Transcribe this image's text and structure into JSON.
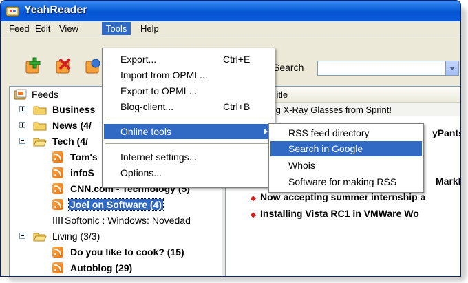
{
  "window": {
    "title": "YeahReader"
  },
  "menubar": {
    "items": [
      "Feed",
      "Edit",
      "View",
      "Tools",
      "Help"
    ],
    "active": "Tools"
  },
  "toolbar": {
    "search_label": "Search"
  },
  "tree": {
    "root": "Feeds",
    "rows": [
      {
        "label": "Business",
        "kind": "folder",
        "expander": "plus"
      },
      {
        "label": "News (4/",
        "kind": "folder",
        "expander": "plus"
      },
      {
        "label": "Tech (4/",
        "kind": "folder",
        "expander": "minus"
      },
      {
        "label": "Tom's",
        "kind": "feed"
      },
      {
        "label": "infoS",
        "kind": "feed"
      },
      {
        "label": "CNN.com - Technology (5)",
        "kind": "feed"
      },
      {
        "label": "Joel on Software (4)",
        "kind": "feed",
        "selected": true
      },
      {
        "label": "Softonic : Windows: Novedad",
        "kind": "feed-plain"
      },
      {
        "label": "Living (3/3)",
        "kind": "folder",
        "expander": "minus"
      },
      {
        "label": "Do you like to cook? (15)",
        "kind": "feed"
      },
      {
        "label": "Autoblog (29)",
        "kind": "feed"
      }
    ]
  },
  "articles": {
    "column_title": "Title",
    "first_row": "mazing X-Ray Glasses from Sprint!",
    "partials": [
      "yPants",
      "MarkD"
    ],
    "items": [
      "Now accepting summer internship a",
      "Installing Vista RC1 in VMWare Wo"
    ]
  },
  "tools_menu": {
    "items": [
      {
        "label": "Export...",
        "shortcut": "Ctrl+E"
      },
      {
        "label": "Import from OPML..."
      },
      {
        "label": "Export to OPML..."
      },
      {
        "label": "Blog-client...",
        "shortcut": "Ctrl+B"
      },
      {
        "label": "Online tools",
        "submenu": true
      },
      {
        "label": "Internet settings..."
      },
      {
        "label": "Options..."
      }
    ]
  },
  "online_tools_submenu": {
    "items": [
      "RSS feed directory",
      "Search in Google",
      "Whois",
      "Software for making RSS"
    ],
    "highlighted": "Search in Google"
  },
  "colors": {
    "titlebar": "#0a5fd8",
    "highlight": "#316ac5",
    "menu_bg": "#ece9d8"
  },
  "icons": [
    "yeahreader-app-icon",
    "add-feed-icon",
    "delete-feed-icon",
    "refresh-icon",
    "folder-icon",
    "rss-icon"
  ]
}
